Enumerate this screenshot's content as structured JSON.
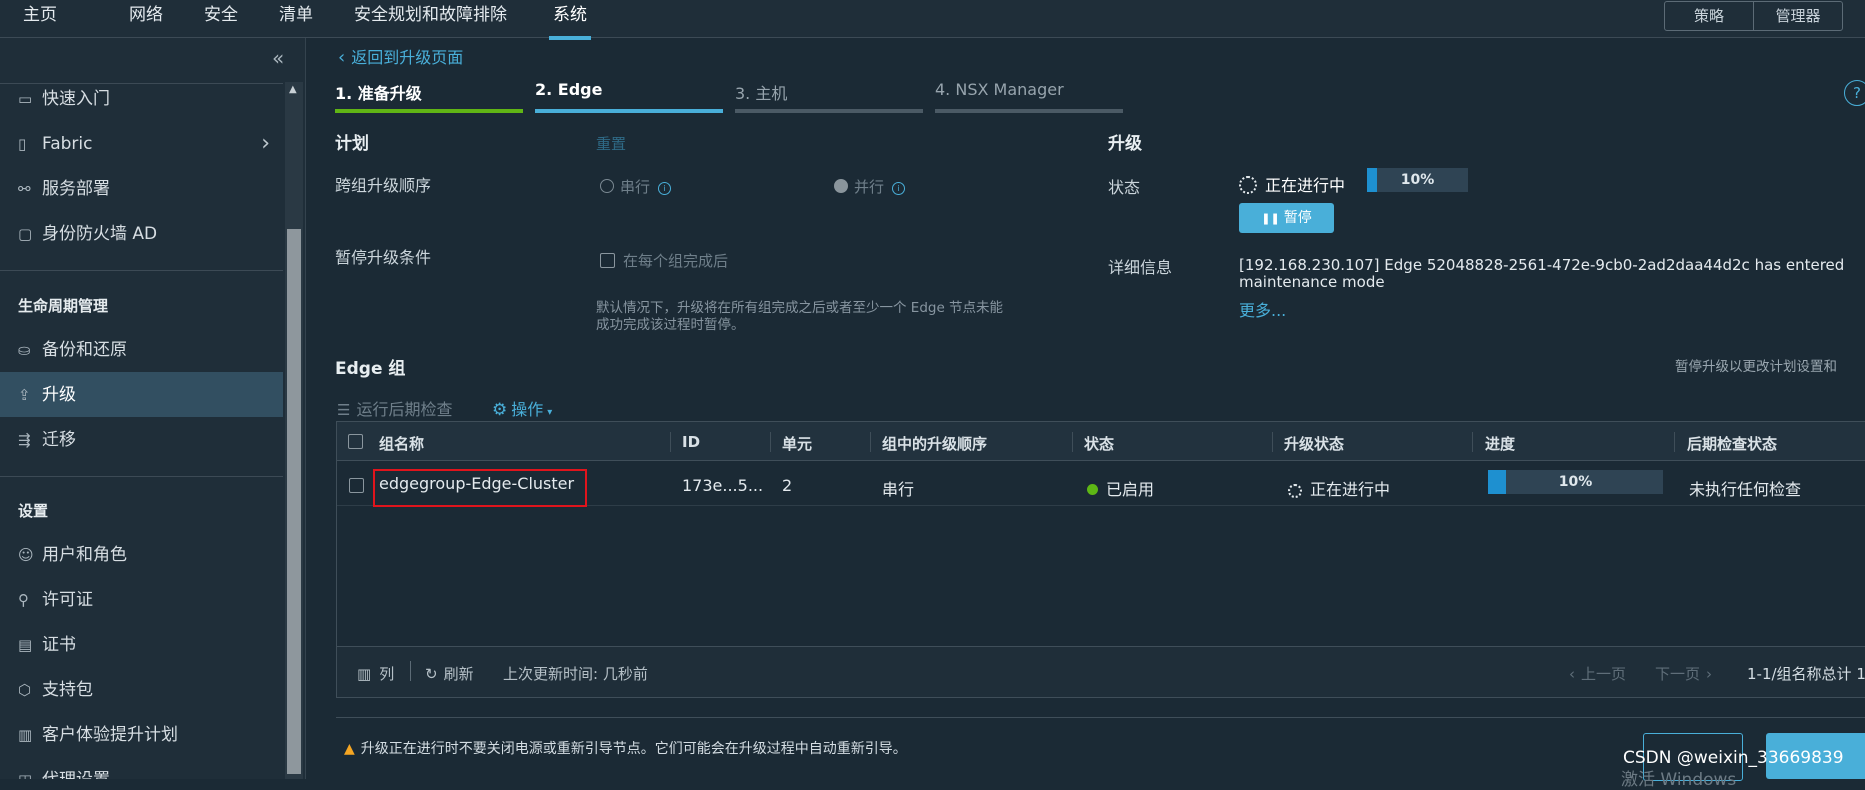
{
  "topnav": {
    "items": [
      "主页",
      "网络",
      "安全",
      "清单",
      "安全规划和故障排除",
      "系统"
    ],
    "active": "系统",
    "right_buttons": [
      "策略",
      "管理器"
    ]
  },
  "sidebar": {
    "collapse_icon": "double-chevron-left-icon",
    "items_top": [
      {
        "label": "快速入门",
        "icon": "laptop-icon"
      },
      {
        "label": "Fabric",
        "icon": "phone-icon",
        "chevron": "›"
      },
      {
        "label": "服务部署",
        "icon": "share-icon"
      },
      {
        "label": "身份防火墙 AD",
        "icon": "folder-icon"
      }
    ],
    "lifecycle_header": "生命周期管理",
    "items_lifecycle": [
      {
        "label": "备份和还原",
        "icon": "backup-icon"
      },
      {
        "label": "升级",
        "icon": "upgrade-icon",
        "active": true
      },
      {
        "label": "迁移",
        "icon": "migrate-icon"
      }
    ],
    "settings_header": "设置",
    "items_settings": [
      {
        "label": "用户和角色",
        "icon": "users-icon"
      },
      {
        "label": "许可证",
        "icon": "license-icon"
      },
      {
        "label": "证书",
        "icon": "certificate-icon"
      },
      {
        "label": "支持包",
        "icon": "package-icon"
      },
      {
        "label": "客户体验提升计划",
        "icon": "chart-icon"
      },
      {
        "label": "代理设置",
        "icon": "proxy-icon"
      }
    ]
  },
  "main": {
    "back_link": "返回到升级页面",
    "help_icon": "?",
    "steps": [
      {
        "label": "1. 准备升级",
        "color": "#60b515"
      },
      {
        "label": "2. Edge",
        "color": "#49afd9"
      },
      {
        "label": "3. 主机",
        "color": "#4b5a65"
      },
      {
        "label": "4. NSX Manager",
        "color": "#4b5a65"
      }
    ],
    "plan": {
      "title": "计划",
      "reset": "重置",
      "order_label": "跨组升级顺序",
      "serial": "串行",
      "parallel": "并行",
      "pause_label": "暂停升级条件",
      "pause_option": "在每个组完成后",
      "note_line1": "默认情况下，升级将在所有组完成之后或者至少一个 Edge 节点未能",
      "note_line2": "成功完成该过程时暂停。"
    },
    "upgrade": {
      "title": "升级",
      "status_label": "状态",
      "status_value": "正在进行中",
      "progress_text": "10%",
      "progress_value": 0.1,
      "pause_button": "暂停",
      "details_label": "详细信息",
      "details_line1": "[192.168.230.107] Edge 52048828-2561-472e-9cb0-2ad2daa44d2c has entered",
      "details_line2": "maintenance mode",
      "more": "更多..."
    },
    "edge_groups": {
      "title": "Edge 组",
      "right_note": "暂停升级以更改计划设置和",
      "run_check": "运行后期检查",
      "actions": "操作",
      "columns": [
        "组名称",
        "ID",
        "单元",
        "组中的升级顺序",
        "状态",
        "升级状态",
        "进度",
        "后期检查状态"
      ],
      "row": {
        "name": "edgegroup-Edge-Cluster",
        "id": "173e...5...",
        "units": "2",
        "order": "串行",
        "state": "已启用",
        "upgrade_status": "正在进行中",
        "progress_text": "10%",
        "progress_value": 0.1,
        "post_check": "未执行任何检查"
      },
      "footer": {
        "columns": "列",
        "refresh": "刷新",
        "last_update": "上次更新时间: 几秒前",
        "prev": "上一页",
        "next": "下一页",
        "range": "1-1/组名称总计 1"
      }
    },
    "warning": "升级正在进行时不要关闭电源或重新引导节点。它们可能会在升级过程中自动重新引导。",
    "watermark": "CSDN @weixin_33669839",
    "activate": "激活 Windows"
  }
}
